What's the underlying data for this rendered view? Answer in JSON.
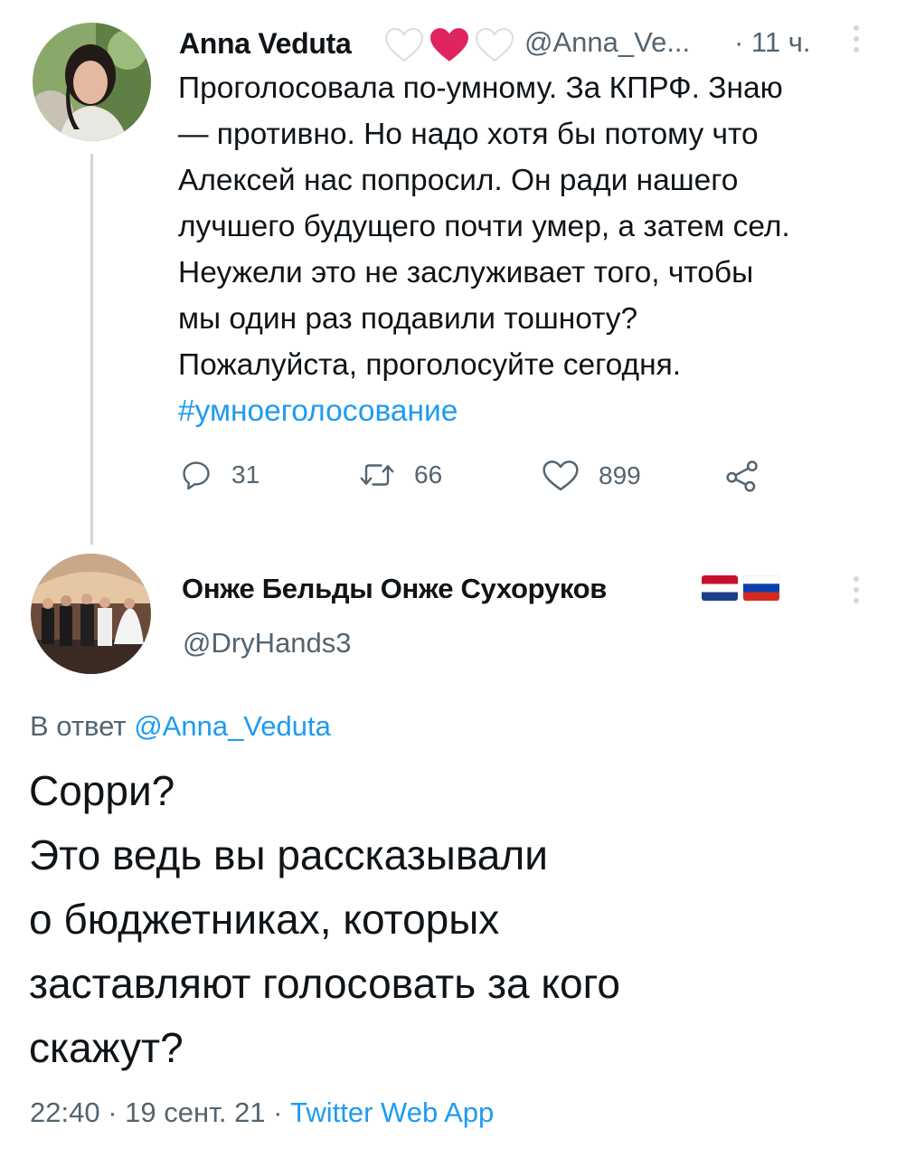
{
  "tweet": {
    "author_name": "Anna Veduta",
    "handle": "@Anna_Ve...",
    "time": "· 11 ч.",
    "text_lines": [
      "Проголосовала по-умному. За КПРФ. Знаю",
      "— противно. Но надо хотя бы потому что",
      "Алексей нас попросил. Он ради нашего",
      "лучшего будущего почти умер, а затем сел.",
      "Неужели это не заслуживает того, чтобы",
      "мы один раз подавили тошноту?",
      "Пожалуйста, проголосуйте сегодня."
    ],
    "hashtag": "#умноеголосование",
    "replies": "31",
    "retweets": "66",
    "likes": "899",
    "name_emoji": [
      "white-heart-icon",
      "red-heart-icon",
      "white-heart-icon"
    ]
  },
  "reply": {
    "author_name": "Онже Бельды Онже Сухоруков",
    "handle": "@DryHands3",
    "flags": [
      "netherlands-flag-icon",
      "russia-flag-icon"
    ],
    "in_reply_prefix": "В ответ",
    "in_reply_handle": "@Anna_Veduta",
    "text_lines": [
      "Сорри?",
      "Это ведь вы рассказывали",
      "о бюджетниках, которых",
      "заставляют голосовать за кого",
      "скажут?"
    ],
    "timestamp": "22:40 · 19 сент. 21 ·",
    "source": "Twitter Web App"
  },
  "colors": {
    "text": "#0f1419",
    "muted": "#536471",
    "link": "#1d9bf0",
    "heart_red": "#e0245e",
    "thread_line": "#cfd9de"
  }
}
